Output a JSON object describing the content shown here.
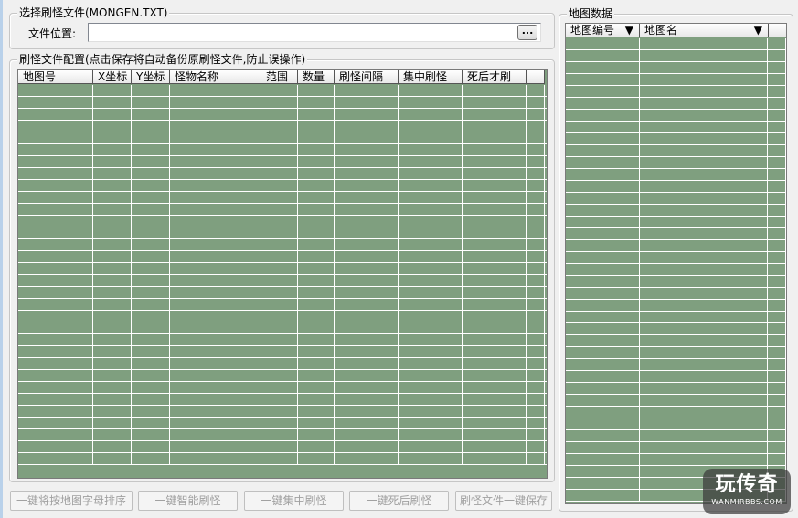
{
  "file_group": {
    "title": "选择刷怪文件(MONGEN.TXT)",
    "path_label": "文件位置:",
    "path_value": "",
    "browse_label": "..."
  },
  "config_group": {
    "title": "刷怪文件配置(点击保存将自动备份原刷怪文件,防止误操作)",
    "columns": [
      "地图号",
      "X坐标",
      "Y坐标",
      "怪物名称",
      "范围",
      "数量",
      "刷怪间隔",
      "集中刷怪",
      "死后才刷",
      ""
    ],
    "row_count": 32
  },
  "map_group": {
    "title": "地图数据",
    "columns": [
      "地图编号",
      "地图名",
      ""
    ],
    "sort_icon": "▼",
    "row_count": 39
  },
  "buttons": {
    "sort_by_letter": "一键将按地图字母排序",
    "smart_spawn": "一键智能刷怪",
    "concentrated_spawn": "一键集中刷怪",
    "spawn_after_death": "一键死后刷怪",
    "save_file": "刷怪文件一键保存"
  },
  "watermark": {
    "main": "玩传奇",
    "sub": "WANMIRBBS.COM"
  },
  "colors": {
    "grid_fill": "#7f9f7f",
    "grid_line": "#ffffff",
    "disabled_text": "#a0a0a0"
  }
}
